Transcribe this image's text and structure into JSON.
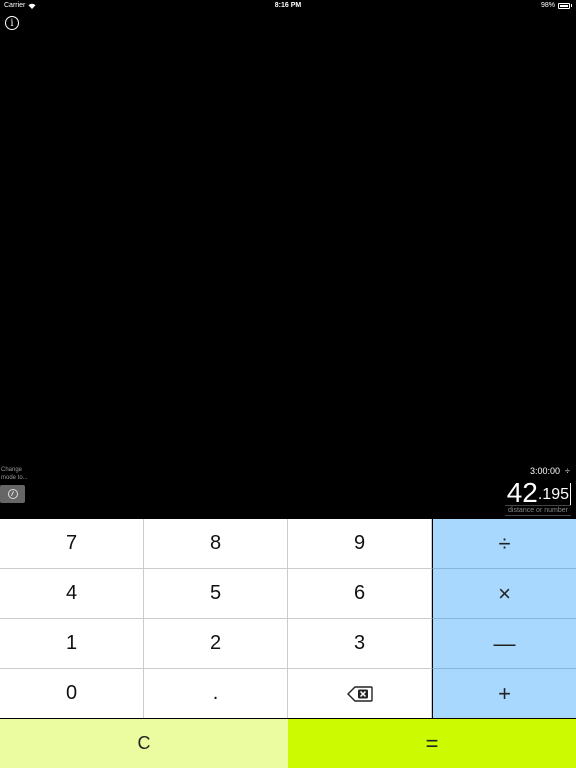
{
  "status_bar": {
    "carrier": "Carrier",
    "time": "8:16 PM",
    "battery": "98%",
    "icons": [
      "wifi-icon",
      "battery-icon"
    ]
  },
  "info": {
    "icon": "i"
  },
  "mode": {
    "label_line1": "Change",
    "label_line2": "mode to...",
    "icon": "stopwatch-icon"
  },
  "display": {
    "time": "3:00:00",
    "time_operator": "÷",
    "value_int": "42",
    "value_frac": ".195",
    "hint": "distance or number"
  },
  "keypad": {
    "rows": [
      [
        "7",
        "8",
        "9",
        "÷"
      ],
      [
        "4",
        "5",
        "6",
        "×"
      ],
      [
        "1",
        "2",
        "3",
        "—"
      ],
      [
        "0",
        ".",
        "",
        "+"
      ]
    ],
    "backspace_icon": "backspace-icon"
  },
  "bottom": {
    "clear": "C",
    "equals": "="
  },
  "colors": {
    "operator_bg": "#a9d8fe",
    "clear_bg": "#eafc9f",
    "equals_bg": "#ccfa00"
  }
}
